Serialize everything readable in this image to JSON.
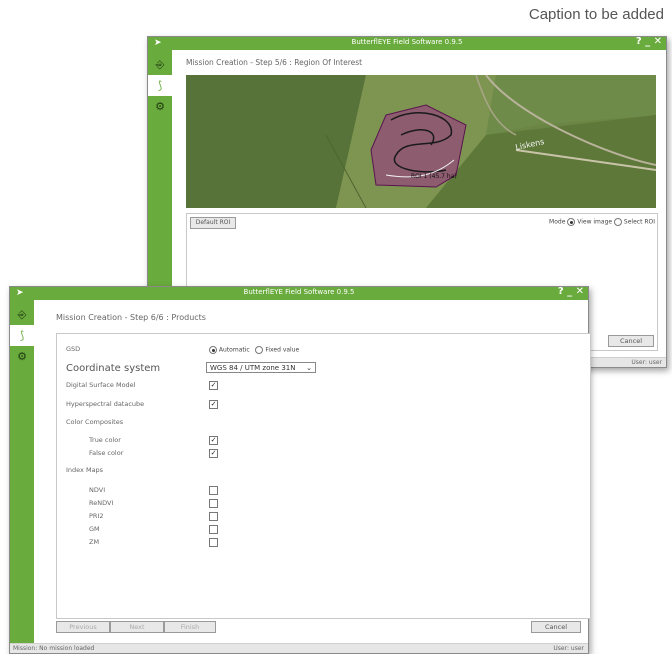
{
  "caption": "Caption to be added",
  "back_window": {
    "title": "ButterflEYE Field Software 0.9.5",
    "controls": "? _ ✕",
    "step_title": "Mission Creation - Step 5/6 : Region Of Interest",
    "map": {
      "roi_label": "ROI 1 (45.7 ha)",
      "place_label": "Liskens"
    },
    "default_roi_label": "Default ROI",
    "mode_label": "Mode",
    "mode_options": [
      "View image",
      "Select ROI"
    ],
    "cancel_label": "Cancel",
    "user_label": "User: user"
  },
  "front_window": {
    "title": "ButterflEYE Field Software 0.9.5",
    "controls": "? _ ✕",
    "step_title": "Mission Creation - Step 6/6 : Products",
    "gsd": {
      "label": "GSD",
      "options": [
        "Automatic",
        "Fixed value"
      ]
    },
    "coordinate_system": {
      "label": "Coordinate system",
      "value": "WGS 84 / UTM zone 31N"
    },
    "dsm": {
      "label": "Digital Surface Model",
      "checked": true
    },
    "hyperspectral": {
      "label": "Hyperspectral datacube",
      "checked": true
    },
    "color_composites": {
      "label": "Color Composites",
      "items": [
        {
          "label": "True color",
          "checked": true
        },
        {
          "label": "False color",
          "checked": true
        }
      ]
    },
    "index_maps": {
      "label": "Index Maps",
      "items": [
        {
          "label": "NDVI",
          "checked": false
        },
        {
          "label": "ReNDVI",
          "checked": false
        },
        {
          "label": "PRI2",
          "checked": false
        },
        {
          "label": "GM",
          "checked": false
        },
        {
          "label": "ZM",
          "checked": false
        }
      ]
    },
    "buttons": {
      "previous": "Previous",
      "next": "Next",
      "finish": "Finish",
      "cancel": "Cancel"
    },
    "status": "Mission: No mission loaded",
    "user_label": "User: user"
  },
  "colors": {
    "accent": "#6aab3d",
    "roi": "#9b2d86"
  }
}
